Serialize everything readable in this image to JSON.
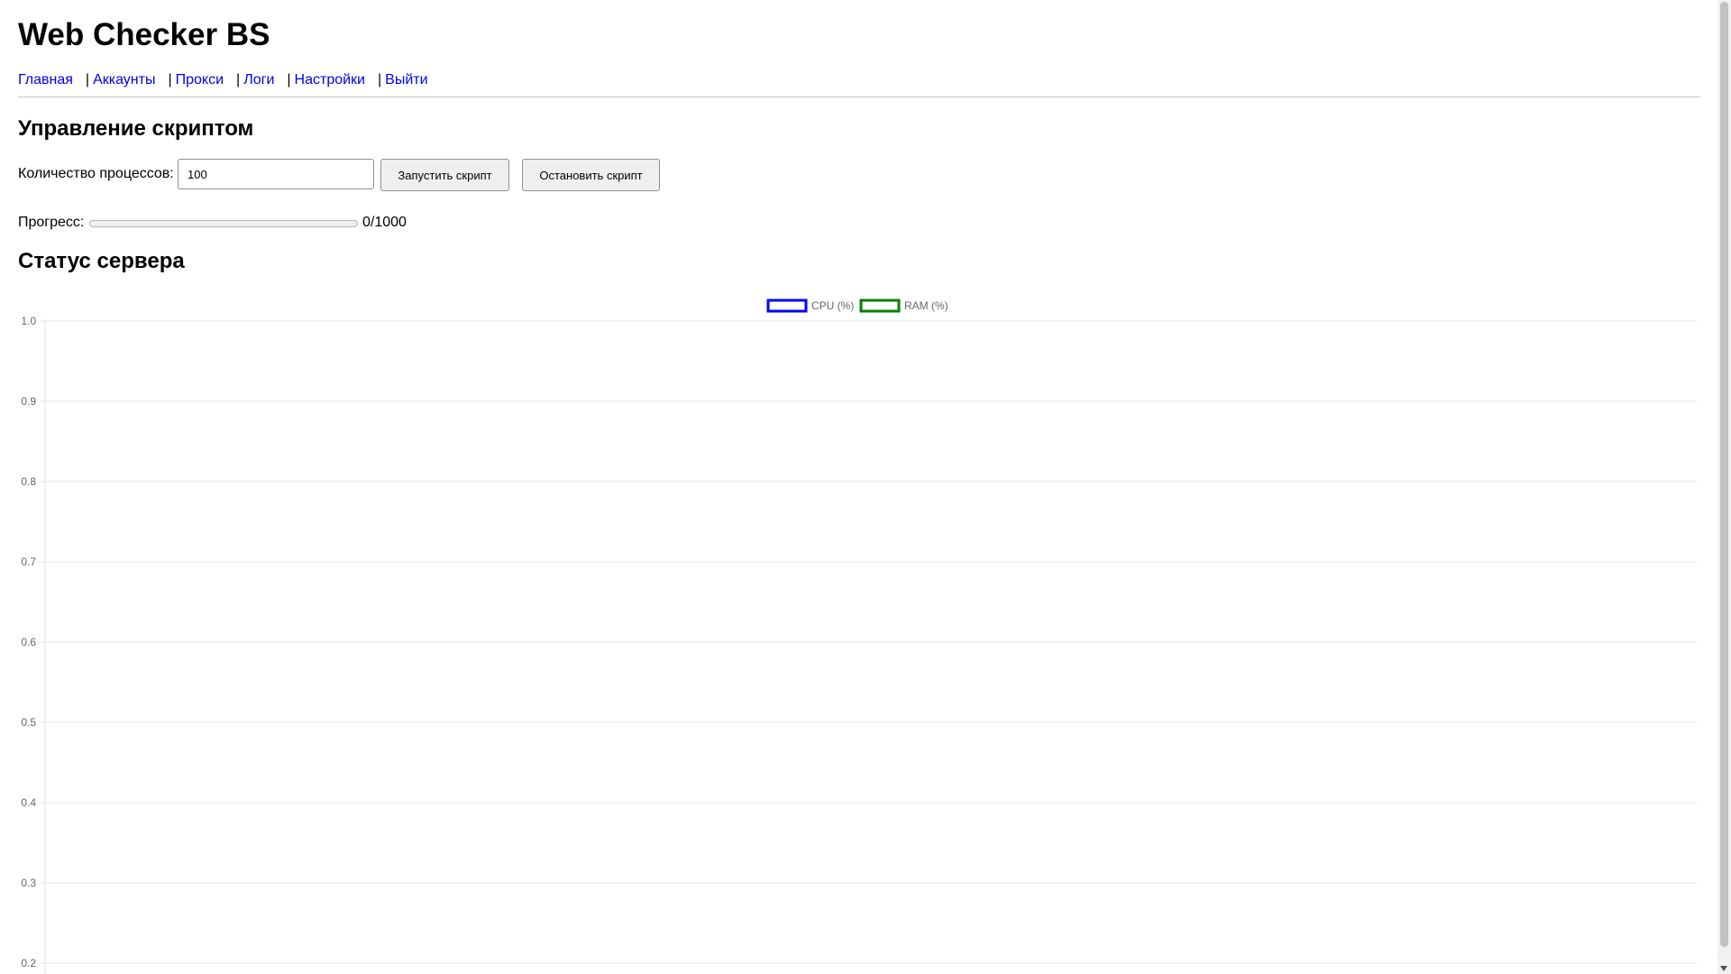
{
  "header": {
    "title": "Web Checker BS"
  },
  "nav": {
    "separator": "|",
    "items": [
      "Главная",
      "Аккаунты",
      "Прокси",
      "Логи",
      "Настройки",
      "Выйти"
    ]
  },
  "control": {
    "heading": "Управление скриптом",
    "process_label": "Количество процессов:",
    "process_value": "100",
    "start_label": "Запустить скрипт",
    "stop_label": "Остановить скрипт",
    "progress_label": "Прогресс:",
    "progress_text": "0/1000",
    "progress_fraction": 0
  },
  "status": {
    "heading": "Статус сервера"
  },
  "colors": {
    "link": "#0000ee",
    "cpu": "#0000ff",
    "ram": "#008000",
    "grid": "#e5e5e5"
  },
  "chart_data": {
    "type": "line",
    "title": "",
    "xlabel": "",
    "ylabel": "",
    "ylim": [
      0.2,
      1.0
    ],
    "yticks": [
      "1.0",
      "0.9",
      "0.8",
      "0.7",
      "0.6",
      "0.5",
      "0.4",
      "0.3",
      "0.2"
    ],
    "grid": true,
    "legend_position": "top-center",
    "series": [
      {
        "name": "CPU (%)",
        "color": "#0000ff",
        "values": []
      },
      {
        "name": "RAM (%)",
        "color": "#008000",
        "values": []
      }
    ]
  }
}
